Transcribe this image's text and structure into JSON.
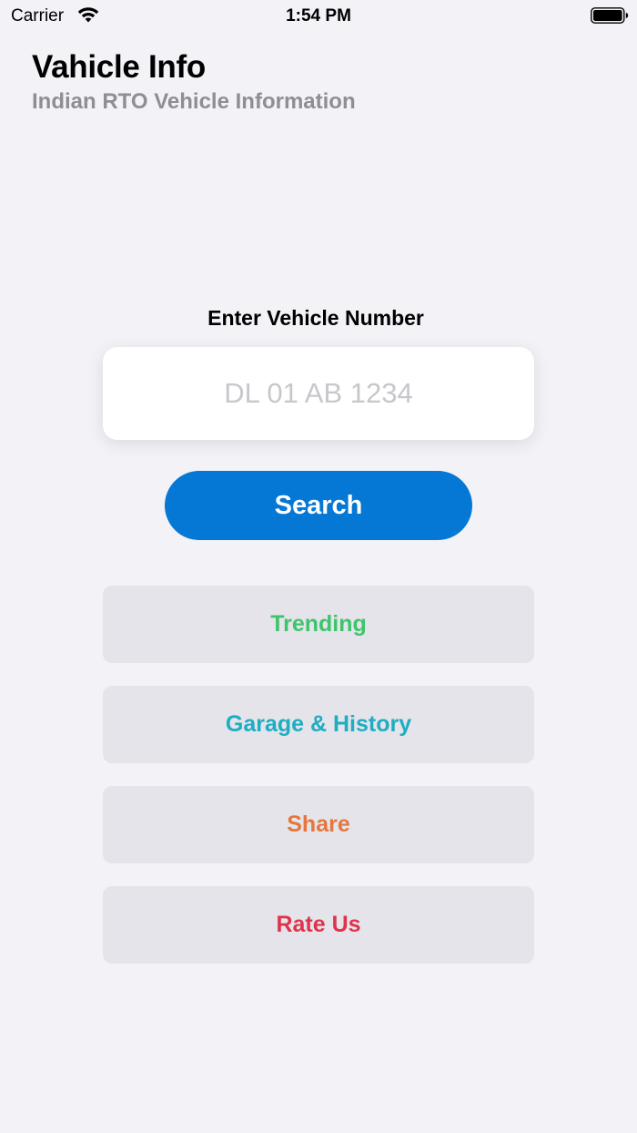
{
  "status_bar": {
    "carrier": "Carrier",
    "time": "1:54 PM",
    "wifi_icon": "wifi-icon",
    "battery_icon": "battery-icon"
  },
  "header": {
    "title": "Vahicle Info",
    "subtitle": "Indian RTO Vehicle Information"
  },
  "search": {
    "label": "Enter Vehicle Number",
    "value": "",
    "placeholder": "DL 01 AB 1234",
    "button_label": "Search",
    "button_color": "#0577d5"
  },
  "menu": {
    "trending": {
      "label": "Trending",
      "color": "#3ec46d"
    },
    "garage_history": {
      "label": "Garage & History",
      "color": "#1fadc2"
    },
    "share": {
      "label": "Share",
      "color": "#e5773d"
    },
    "rate_us": {
      "label": "Rate Us",
      "color": "#e0334b"
    }
  }
}
